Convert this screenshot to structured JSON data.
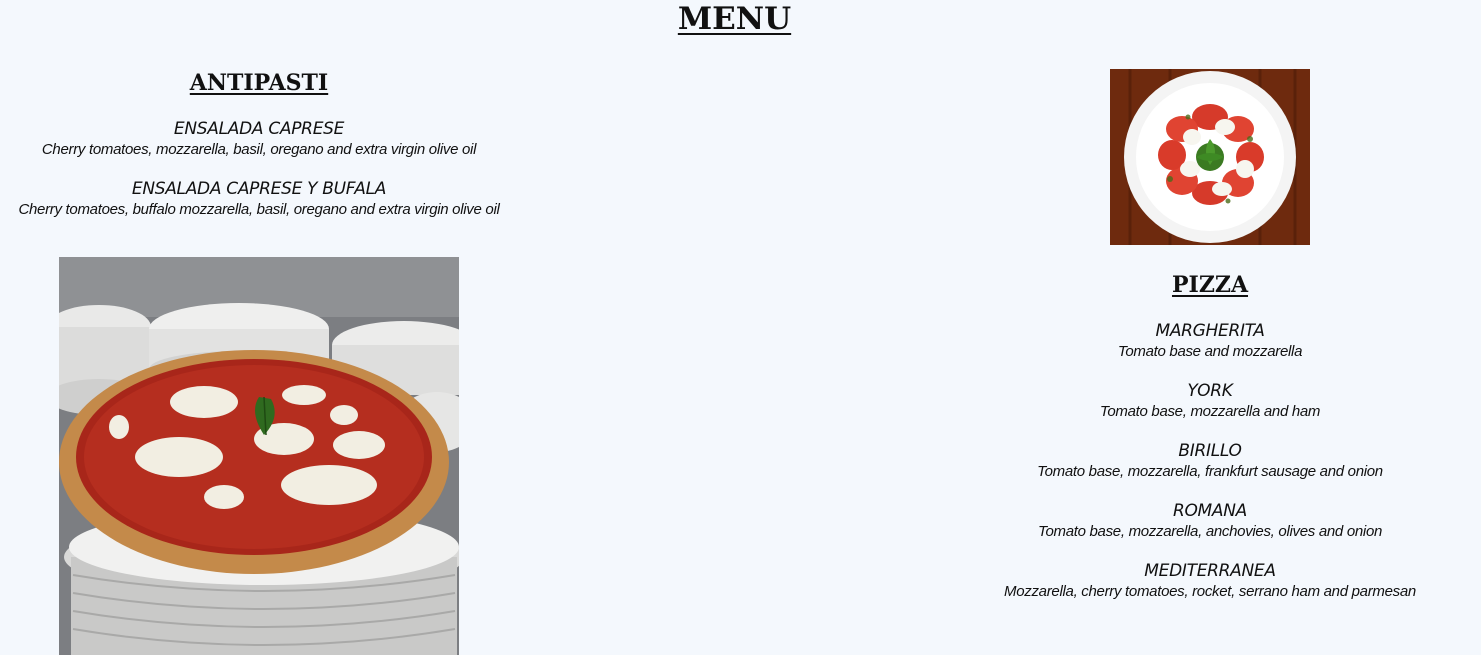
{
  "menu": {
    "title": "MENU"
  },
  "antipasti": {
    "title": "ANTIPASTI",
    "items": [
      {
        "name": "ENSALADA CAPRESE",
        "description": "Cherry tomatoes, mozzarella, basil, oregano and extra virgin olive oil"
      },
      {
        "name": "ENSALADA CAPRESE Y BUFALA",
        "description": "Cherry tomatoes, buffalo mozzarella, basil, oregano and extra virgin olive oil"
      }
    ]
  },
  "pizza": {
    "title": "PIZZA",
    "items": [
      {
        "name": "MARGHERITA",
        "description": "Tomato base and mozzarella"
      },
      {
        "name": "YORK",
        "description": "Tomato base, mozzarella and ham"
      },
      {
        "name": "BIRILLO",
        "description": "Tomato base, mozzarella, frankfurt sausage and onion"
      },
      {
        "name": "ROMANA",
        "description": "Tomato base, mozzarella, anchovies, olives and onion"
      },
      {
        "name": "MEDITERRANEA",
        "description": "Mozzarella, cherry tomatoes, rocket, serrano ham and parmesan"
      }
    ]
  },
  "images": {
    "caprese_photo": "caprese-salad-photo",
    "pizza_photo": "margherita-pizza-photo"
  },
  "colors": {
    "background": "#f4f8fd",
    "text": "#111111"
  }
}
